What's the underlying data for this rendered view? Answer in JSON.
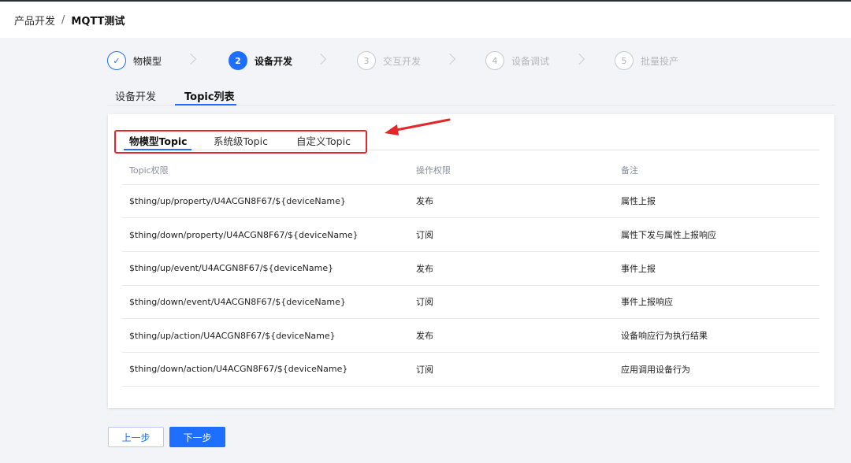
{
  "breadcrumb": {
    "parent": "产品开发",
    "separator": "/",
    "current": "MQTT测试"
  },
  "stepper": {
    "steps": [
      {
        "index": "✓",
        "label": "物模型",
        "state": "done"
      },
      {
        "index": "2",
        "label": "设备开发",
        "state": "active"
      },
      {
        "index": "3",
        "label": "交互开发",
        "state": "todo"
      },
      {
        "index": "4",
        "label": "设备调试",
        "state": "todo"
      },
      {
        "index": "5",
        "label": "批量投产",
        "state": "todo"
      }
    ]
  },
  "outer_tabs": {
    "items": [
      {
        "label": "设备开发"
      },
      {
        "label": "Topic列表",
        "active": true
      }
    ]
  },
  "inner_tabs": {
    "items": [
      {
        "label": "物模型Topic",
        "active": true
      },
      {
        "label": "系统级Topic"
      },
      {
        "label": "自定义Topic"
      }
    ]
  },
  "table": {
    "headers": [
      "Topic权限",
      "操作权限",
      "备注"
    ],
    "rows": [
      {
        "topic": "$thing/up/property/U4ACGN8F67/${deviceName}",
        "permission": "发布",
        "note": "属性上报"
      },
      {
        "topic": "$thing/down/property/U4ACGN8F67/${deviceName}",
        "permission": "订阅",
        "note": "属性下发与属性上报响应"
      },
      {
        "topic": "$thing/up/event/U4ACGN8F67/${deviceName}",
        "permission": "发布",
        "note": "事件上报"
      },
      {
        "topic": "$thing/down/event/U4ACGN8F67/${deviceName}",
        "permission": "订阅",
        "note": "事件上报响应"
      },
      {
        "topic": "$thing/up/action/U4ACGN8F67/${deviceName}",
        "permission": "发布",
        "note": "设备响应行为执行结果"
      },
      {
        "topic": "$thing/down/action/U4ACGN8F67/${deviceName}",
        "permission": "订阅",
        "note": "应用调用设备行为"
      }
    ]
  },
  "buttons": {
    "prev_label": "上一步",
    "next_label": "下一步"
  },
  "colors": {
    "primary": "#1e6fff",
    "annotation_red": "#e3262a"
  }
}
